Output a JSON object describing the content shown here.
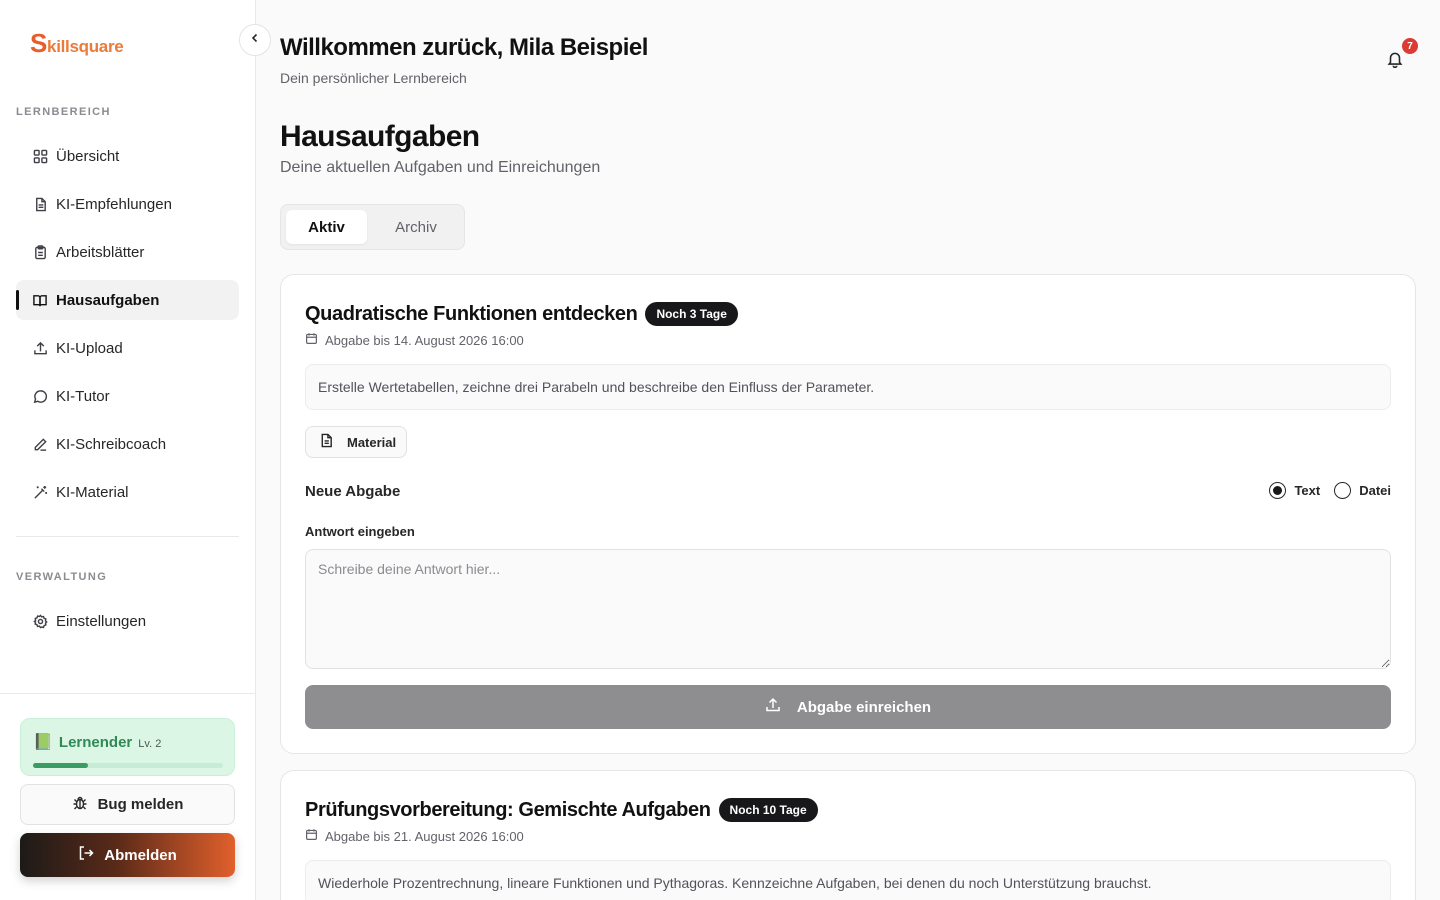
{
  "brand": {
    "logo_first": "S",
    "logo_rest": "killsquare"
  },
  "sidebar": {
    "section_learning": "LERNBEREICH",
    "items": [
      {
        "label": "Übersicht",
        "icon": "grid-icon"
      },
      {
        "label": "KI-Empfehlungen",
        "icon": "file-text-icon"
      },
      {
        "label": "Arbeitsblätter",
        "icon": "clipboard-icon"
      },
      {
        "label": "Hausaufgaben",
        "icon": "book-open-icon",
        "active": true
      },
      {
        "label": "KI-Upload",
        "icon": "upload-icon"
      },
      {
        "label": "KI-Tutor",
        "icon": "chat-bubble-icon"
      },
      {
        "label": "KI-Schreibcoach",
        "icon": "pen-icon"
      },
      {
        "label": "KI-Material",
        "icon": "magic-wand-icon"
      }
    ],
    "section_admin": "VERWALTUNG",
    "admin_items": [
      {
        "label": "Einstellungen",
        "icon": "gear-icon"
      }
    ],
    "level": {
      "emoji": "📗",
      "name": "Lernender",
      "level_label": "Lv. 2",
      "progress": 0.29
    },
    "bug_label": "Bug melden",
    "logout_label": "Abmelden"
  },
  "header": {
    "welcome": "Willkommen zurück, Mila Beispiel",
    "subtitle": "Dein persönlicher Lernbereich",
    "notification_count": "7"
  },
  "page": {
    "title": "Hausaufgaben",
    "subtitle": "Deine aktuellen Aufgaben und Einreichungen",
    "tabs": [
      {
        "label": "Aktiv",
        "active": true
      },
      {
        "label": "Archiv"
      }
    ]
  },
  "assignments": [
    {
      "title": "Quadratische Funktionen entdecken",
      "badge": "Noch 3 Tage",
      "due": "Abgabe bis 14. August 2026 16:00",
      "description": "Erstelle Wertetabellen, zeichne drei Parabeln und beschreibe den Einfluss der Parameter.",
      "material_label": "Material",
      "new_submission_label": "Neue Abgabe",
      "option_text": "Text",
      "option_file": "Datei",
      "answer_label": "Antwort eingeben",
      "answer_placeholder": "Schreibe deine Antwort hier...",
      "submit_label": "Abgabe einreichen"
    },
    {
      "title": "Prüfungsvorbereitung: Gemischte Aufgaben",
      "badge": "Noch 10 Tage",
      "due": "Abgabe bis 21. August 2026 16:00",
      "description": "Wiederhole Prozentrechnung, lineare Funktionen und Pythagoras. Kennzeichne Aufgaben, bei denen du noch Unterstützung brauchst."
    }
  ],
  "colors": {
    "brand": "#e85d2a",
    "accent_dark": "#18181b",
    "level_green": "#3a9c63",
    "badge_red": "#dc3b34"
  }
}
